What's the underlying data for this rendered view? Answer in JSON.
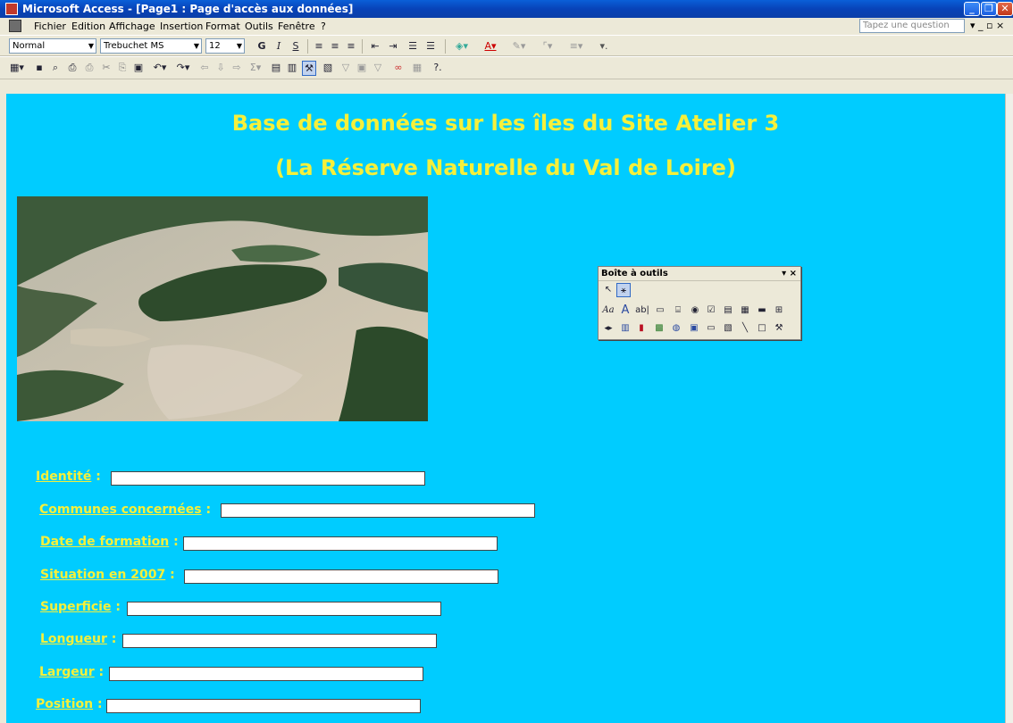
{
  "window": {
    "title": "Microsoft Access - [Page1 : Page d'accès aux données]",
    "minimize_glyph": "_",
    "restore_glyph": "❐",
    "close_glyph": "✕"
  },
  "menu": {
    "items": [
      "Fichier",
      "Edition",
      "Affichage",
      "Insertion",
      "Format",
      "Outils",
      "Fenêtre",
      "?"
    ],
    "help_placeholder": "Tapez une question",
    "mdi_controls": "▾ _ ▫ ×"
  },
  "format_toolbar": {
    "style": "Normal",
    "font": "Trebuchet MS",
    "size": "12",
    "bold": "G",
    "italic": "I",
    "underline": "S"
  },
  "form": {
    "title_line1": "Base de données sur les îles du Site Atelier 3",
    "title_line2": "(La Réserve Naturelle du Val de Loire)",
    "fields": [
      {
        "label": "Identité",
        "value": ""
      },
      {
        "label": "Communes concernées",
        "value": ""
      },
      {
        "label": "Date de formation",
        "value": ""
      },
      {
        "label": "Situation en 2007",
        "value": ""
      },
      {
        "label": "Superficie",
        "value": ""
      },
      {
        "label": "Longueur",
        "value": ""
      },
      {
        "label": "Largeur",
        "value": ""
      },
      {
        "label": "Position",
        "value": ""
      }
    ],
    "colors": {
      "background": "#00ccff",
      "label": "#f6f03a"
    }
  },
  "toolbox": {
    "title": "Boîte à outils",
    "controls": "▾ ×",
    "row0": [
      "↖",
      "⚹"
    ],
    "row1": [
      "Aa",
      "A",
      "ab|",
      "▭",
      "⌸",
      "◉",
      "☑",
      "▤",
      "▦",
      "▬",
      "⊞"
    ],
    "row2": [
      "◂▸",
      "▥",
      "▮",
      "▩",
      "◍",
      "▣",
      "▭",
      "▧",
      "╲",
      "□",
      "⚒"
    ]
  }
}
